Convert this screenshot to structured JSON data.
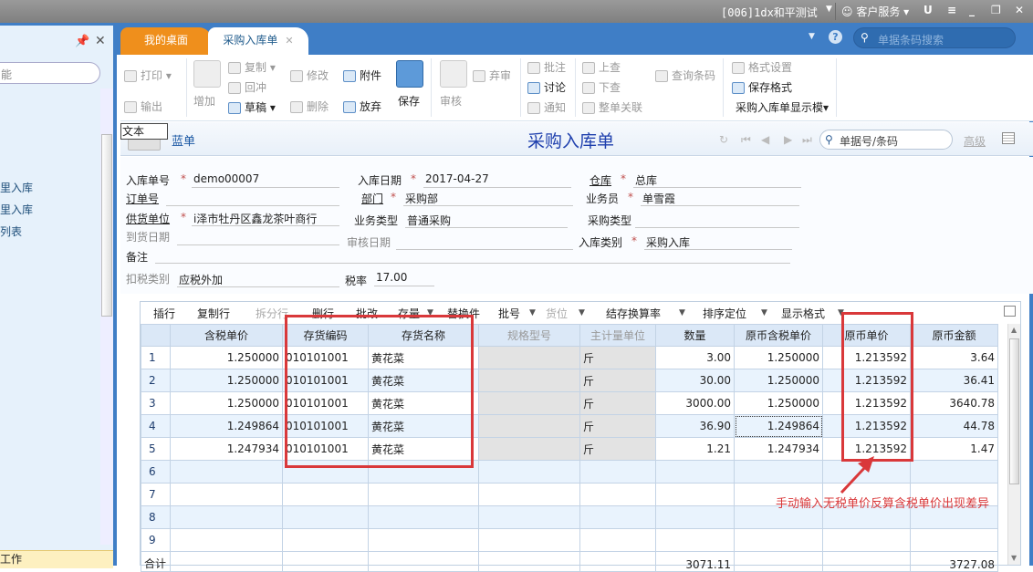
{
  "window": {
    "account": "[006]1dx和平测试",
    "service": "客户服务",
    "buttons": [
      "U",
      "≡",
      "_",
      "❐",
      "✕"
    ]
  },
  "left_panel": {
    "search_placeholder": "能",
    "items": [
      "里入库",
      "里入库",
      "列表"
    ],
    "footer": "工作"
  },
  "tabs": [
    {
      "label": "我的桌面",
      "active": false
    },
    {
      "label": "采购入库单",
      "active": true
    }
  ],
  "global_search": {
    "placeholder": "单据条码搜索"
  },
  "ribbon": {
    "print": "打印",
    "export": "输出",
    "add": "增加",
    "copy": "复制",
    "reverse": "回冲",
    "draft": "草稿",
    "modify": "修改",
    "delete": "删除",
    "attach": "附件",
    "abandon": "放弃",
    "save": "保存",
    "audit": "审核",
    "unaudit": "弃审",
    "annotate": "批注",
    "discuss": "讨论",
    "notify": "通知",
    "up_query": "上查",
    "down_query": "下查",
    "link": "整单关联",
    "barcode": "查询条码",
    "format_setting": "格式设置",
    "save_format": "保存格式",
    "display_template": "采购入库单显示模▾"
  },
  "title_row": {
    "tooltip": "文本",
    "blue_bill": "蓝单",
    "form_title": "采购入库单",
    "doc_search_placeholder": "单据号/条码",
    "advanced": "高级"
  },
  "form": {
    "receipt_no": {
      "label": "入库单号",
      "value": "demo00007"
    },
    "receipt_date": {
      "label": "入库日期",
      "value": "2017-04-27"
    },
    "warehouse": {
      "label": "仓库",
      "value": "总库"
    },
    "order_no": {
      "label": "订单号",
      "value": ""
    },
    "dept": {
      "label": "部门",
      "value": "采购部"
    },
    "salesman": {
      "label": "业务员",
      "value": "单雪霞"
    },
    "supplier": {
      "label": "供货单位",
      "value": "i泽市牡丹区鑫龙茶叶商行"
    },
    "biz_type": {
      "label": "业务类型",
      "value": "普通采购"
    },
    "purchase_type": {
      "label": "采购类型",
      "value": ""
    },
    "arrival_date": {
      "label": "到货日期",
      "value": ""
    },
    "audit_date": {
      "label": "审核日期",
      "value": ""
    },
    "in_category": {
      "label": "入库类别",
      "value": "采购入库"
    },
    "remark": {
      "label": "备注",
      "value": ""
    },
    "tax_category": {
      "label": "扣税类别",
      "value": "应税外加"
    },
    "tax_rate": {
      "label": "税率",
      "value": "17.00"
    }
  },
  "grid_toolbar": [
    "插行",
    "复制行",
    "拆分行",
    "删行",
    "批改",
    "存量",
    "替换件",
    "批号",
    "货位",
    "结存换算率",
    "排序定位",
    "显示格式"
  ],
  "grid": {
    "columns": [
      "",
      "含税单价",
      "存货编码",
      "存货名称",
      "规格型号",
      "主计量单位",
      "数量",
      "原币含税单价",
      "原币单价",
      "原币金额"
    ],
    "rows": [
      [
        "1",
        "1.250000",
        "010101001",
        "黄花菜",
        "",
        "斤",
        "3.00",
        "1.250000",
        "1.213592",
        "3.64"
      ],
      [
        "2",
        "1.250000",
        "010101001",
        "黄花菜",
        "",
        "斤",
        "30.00",
        "1.250000",
        "1.213592",
        "36.41"
      ],
      [
        "3",
        "1.250000",
        "010101001",
        "黄花菜",
        "",
        "斤",
        "3000.00",
        "1.250000",
        "1.213592",
        "3640.78"
      ],
      [
        "4",
        "1.249864",
        "010101001",
        "黄花菜",
        "",
        "斤",
        "36.90",
        "1.249864",
        "1.213592",
        "44.78"
      ],
      [
        "5",
        "1.247934",
        "010101001",
        "黄花菜",
        "",
        "斤",
        "1.21",
        "1.247934",
        "1.213592",
        "1.47"
      ],
      [
        "6",
        "",
        "",
        "",
        "",
        "",
        "",
        "",
        "",
        ""
      ],
      [
        "7",
        "",
        "",
        "",
        "",
        "",
        "",
        "",
        "",
        ""
      ],
      [
        "8",
        "",
        "",
        "",
        "",
        "",
        "",
        "",
        "",
        ""
      ],
      [
        "9",
        "",
        "",
        "",
        "",
        "",
        "",
        "",
        "",
        ""
      ]
    ],
    "total": [
      "合计",
      "",
      "",
      "",
      "",
      "",
      "3071.11",
      "",
      "",
      "3727.08"
    ]
  },
  "annotation": "手动输入无税单价反算含税单价出现差异",
  "colors": {
    "brand_blue": "#3f7ec6",
    "tab_orange": "#ef8f1c",
    "annotation_red": "#d9383a"
  }
}
